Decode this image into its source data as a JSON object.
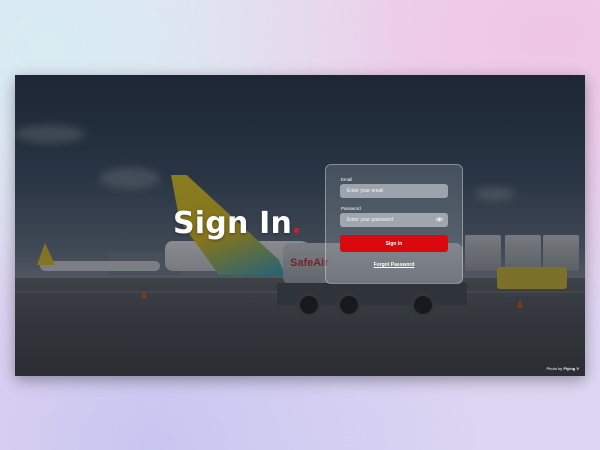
{
  "hero": {
    "title": "Sign In",
    "accent_color": "#e0182c"
  },
  "login": {
    "email_label": "Email",
    "email_placeholder": "Enter your email",
    "password_label": "Password",
    "password_placeholder": "Enter your password",
    "password_toggle_icon": "eye-icon",
    "submit_label": "Sign In",
    "submit_color": "#d9090d",
    "forgot_label": "Forgot Password"
  },
  "background": {
    "truck_text": "SafeAir",
    "credit_prefix": "Photo by",
    "credit_author": "Flying V"
  }
}
